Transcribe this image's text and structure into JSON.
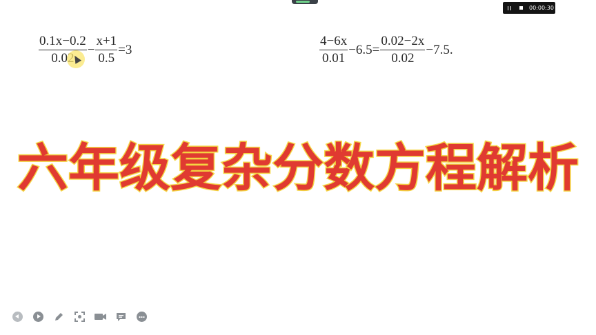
{
  "recorder": {
    "timer": "00:00:30",
    "pause_icon": "pause-icon",
    "stop_icon": "stop-icon"
  },
  "equations": {
    "left": {
      "frac1_num": "0.1x−0.2",
      "frac1_den": "0.02",
      "op1": "−",
      "frac2_num": "x+1",
      "frac2_den": "0.5",
      "rhs": "=3"
    },
    "right": {
      "frac1_num": "4−6x",
      "frac1_den": "0.01",
      "mid": "−6.5=",
      "frac2_num": "0.02−2x",
      "frac2_den": "0.02",
      "tail": "−7.5."
    }
  },
  "title": "六年级复杂分数方程解析",
  "toolbar": {
    "icons": [
      "previous-icon",
      "next-icon",
      "pen-icon",
      "screenshot-icon",
      "camera-icon",
      "comment-icon",
      "more-icon"
    ]
  },
  "colors": {
    "title_fill": "#e03a31",
    "title_stroke": "#f5d84a",
    "toolbar_icon": "#8a8f94"
  }
}
